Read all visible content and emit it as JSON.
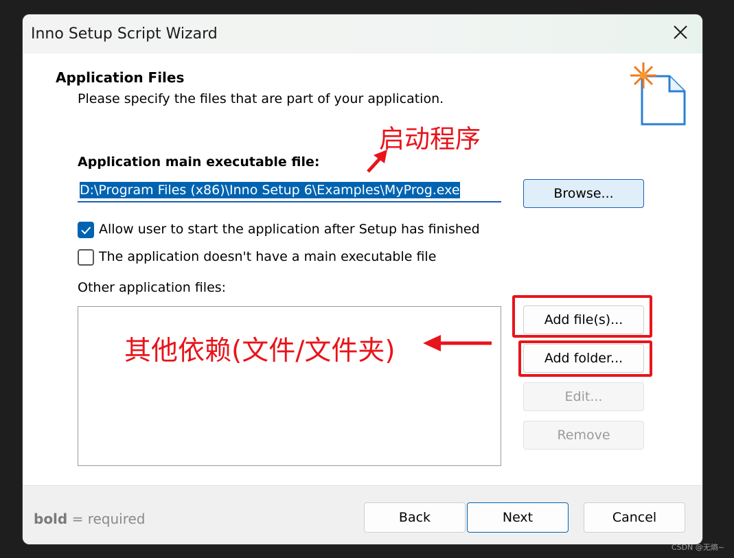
{
  "window": {
    "title": "Inno Setup Script Wizard"
  },
  "page": {
    "heading": "Application Files",
    "subheading": "Please specify the files that are part of your application."
  },
  "main_exe": {
    "label": "Application main executable file:",
    "value": "D:\\Program Files (x86)\\Inno Setup 6\\Examples\\MyProg.exe",
    "browse_label": "Browse..."
  },
  "options": {
    "allow_start": {
      "label": "Allow user to start the application after Setup has finished",
      "checked": true
    },
    "no_main_exe": {
      "label": "The application doesn't have a main executable file",
      "checked": false
    }
  },
  "other_files": {
    "label": "Other application files:",
    "buttons": {
      "add_files": "Add file(s)...",
      "add_folder": "Add folder...",
      "edit": "Edit...",
      "remove": "Remove"
    }
  },
  "footer": {
    "hint_bold": "bold",
    "hint_rest": " = required",
    "back": "Back",
    "next": "Next",
    "cancel": "Cancel"
  },
  "annotations": {
    "startup_program": "启动程序",
    "other_dependencies": "其他依赖(文件/文件夹)",
    "color": "#e8141b"
  },
  "watermark": "CSDN @无熵~",
  "icons": {
    "close": "close-icon",
    "wizard": "new-file-sparkle-icon",
    "check": "checkmark-icon"
  },
  "colors": {
    "accent": "#0063b1",
    "selection": "#0063b1",
    "annotation_red": "#e8141b"
  }
}
